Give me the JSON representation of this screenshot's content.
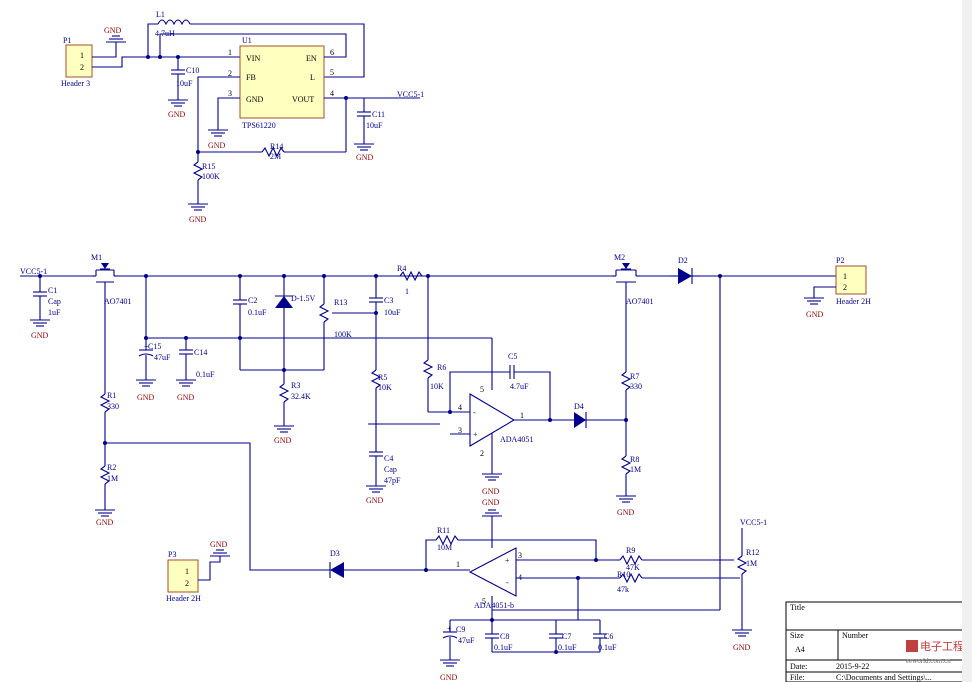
{
  "labels": {
    "P1": "P1",
    "P1_name": "Header 3",
    "P1_pin1": "1",
    "P1_pin2": "2",
    "L1": "L1",
    "L1_val": "4.7uH",
    "U1": "U1",
    "U1_part": "TPS61220",
    "U1_VIN": "VIN",
    "U1_EN": "EN",
    "U1_FB": "FB",
    "U1_L": "L",
    "U1_GND": "GND",
    "U1_VOUT": "VOUT",
    "U1_p1": "1",
    "U1_p2": "2",
    "U1_p3": "3",
    "U1_p4": "4",
    "U1_p5": "5",
    "U1_p6": "6",
    "C10": "C10",
    "C10_val": "10uF",
    "C11": "C11",
    "C11_val": "10uF",
    "R14": "R14",
    "R14_val": "2M",
    "R15": "R15",
    "R15_val": "100K",
    "VCC": "VCC5-1",
    "GND": "GND",
    "M1": "M1",
    "M1_part": "AO7401",
    "M2": "M2",
    "M2_part": "AO7401",
    "D2": "D2",
    "P2": "P2",
    "P2_name": "Header 2H",
    "P2_pin1": "1",
    "P2_pin2": "2",
    "C1": "C1",
    "C1_type": "Cap",
    "C1_val": "1uF",
    "C15": "C15",
    "C15_val": "47uF",
    "C14": "C14",
    "C14_val": "0.1uF",
    "C2": "C2",
    "C2_val": "0.1uF",
    "D1": "D-1.5V",
    "R13": "R13",
    "R13_val": "100K",
    "R3": "R3",
    "R3_val": "32.4K",
    "R4": "R4",
    "R4_val": "1",
    "C3": "C3",
    "C3_val": "10uF",
    "R5": "R5",
    "R5_val": "10K",
    "R6": "R6",
    "R6_val": "10K",
    "C4": "C4",
    "C4_type": "Cap",
    "C4_val": "47pF",
    "C5": "C5",
    "C5_val": "4.7uF",
    "U2": "ADA4051",
    "U2_p1": "1",
    "U2_p2": "2",
    "U2_p3": "3",
    "U2_p4": "4",
    "U2_p5": "5",
    "D4": "D4",
    "R7": "R7",
    "R7_val": "330",
    "R8": "R8",
    "R8_val": "1M",
    "R1": "R1",
    "R1_val": "330",
    "R2": "R2",
    "R2_val": "1M",
    "P3": "P3",
    "P3_name": "Header 2H",
    "P3_pin1": "1",
    "P3_pin2": "2",
    "D3": "D3",
    "R11": "R11",
    "R11_val": "10M",
    "U3": "ADA4051-b",
    "U3_p1": "1",
    "U3_p3": "3",
    "U3_p4": "4",
    "U3_p5": "5",
    "R9": "R9",
    "R9_val": "47K",
    "R10": "R10",
    "R10_val": "47k",
    "R12": "R12",
    "R12_val": "1M",
    "C9": "C9",
    "C9_val": "47uF",
    "C8": "C8",
    "C8_val": "0.1uF",
    "C7": "C7",
    "C7_val": "0.1uF",
    "C6": "C6",
    "C6_val": "0.1uF",
    "plus": "+",
    "minus": "-"
  },
  "title_block": {
    "title": "Title",
    "size_label": "Size",
    "size_value": "A4",
    "number_label": "Number",
    "date_label": "Date:",
    "date_value": "2015-9-22",
    "file_label": "File:",
    "file_value": "C:\\Documents and Settings\\..."
  },
  "watermark": {
    "brand": "电子工程世界",
    "url": "eeworld.com.cn"
  },
  "colors": {
    "wire": "#00008b",
    "ground_label": "#8b0000",
    "component_body": "#ffffc0"
  }
}
